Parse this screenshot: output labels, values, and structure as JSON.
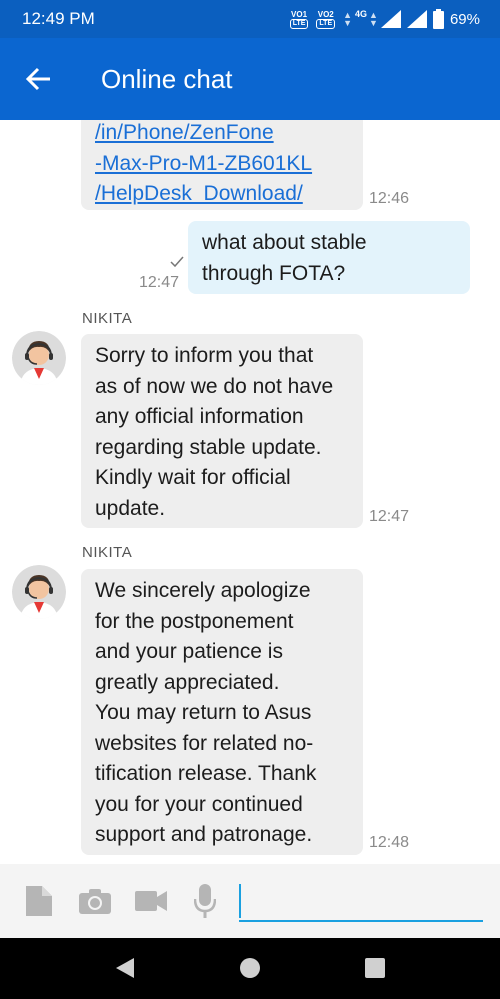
{
  "status": {
    "time": "12:49 PM",
    "sim1": "VO1",
    "sim2": "VO2",
    "lte": "LTE",
    "network": "4G",
    "battery": "69%"
  },
  "app_bar": {
    "title": "Online chat",
    "back_icon": "arrow-left-icon"
  },
  "chat": {
    "messages": [
      {
        "direction": "incoming",
        "lines": [
          "/in/Phone/ZenFone",
          "-Max-Pro-M1-ZB601KL",
          "/HelpDesk_Download/"
        ],
        "time": "12:46"
      },
      {
        "direction": "outgoing",
        "lines": [
          "what about stable",
          "through FOTA?"
        ],
        "time": "12:47"
      },
      {
        "direction": "incoming",
        "sender": "NIKITA",
        "lines": [
          "Sorry to inform you that",
          "as of now we do not have",
          "any official information",
          "regarding stable update.",
          "Kindly wait for official",
          "update."
        ],
        "time": "12:47"
      },
      {
        "direction": "incoming",
        "sender": "NIKITA",
        "lines": [
          "We sincerely apologize",
          "for the postponement",
          "and your patience is",
          "greatly appreciated.",
          "You may return to Asus",
          "websites for related no-",
          "tification release. Thank",
          "you for your continued",
          "support and patronage."
        ],
        "time": "12:48"
      }
    ]
  },
  "input_bar": {
    "icons": [
      "file-icon",
      "camera-icon",
      "video-icon",
      "microphone-icon"
    ],
    "value": "",
    "placeholder": ""
  },
  "colors": {
    "status_bar": "#0b5fbf",
    "app_bar": "#0b66d0",
    "incoming_bubble": "#eeeeee",
    "outgoing_bubble": "#e3f3fb",
    "link": "#1a6fd6",
    "input_underline": "#1aa0e0"
  }
}
